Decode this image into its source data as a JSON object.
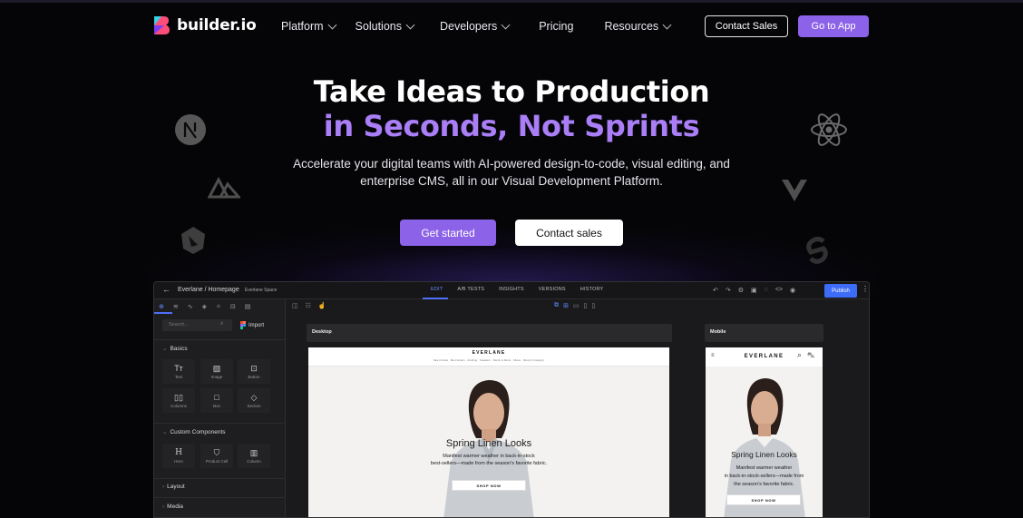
{
  "brand": {
    "name": "builder.io",
    "accent": "#8c63e8",
    "highlight": "#a97ef6"
  },
  "nav": {
    "links": [
      {
        "label": "Platform",
        "dropdown": true
      },
      {
        "label": "Solutions",
        "dropdown": true
      },
      {
        "label": "Developers",
        "dropdown": true
      },
      {
        "label": "Pricing",
        "dropdown": false
      },
      {
        "label": "Resources",
        "dropdown": true
      }
    ],
    "contact_sales": "Contact Sales",
    "go_to_app": "Go to App"
  },
  "hero": {
    "title_line1": "Take Ideas to Production",
    "title_line2": "in Seconds, Not Sprints",
    "subtitle": "Accelerate your digital teams with AI-powered design-to-code, visual editing, and enterprise CMS, all in our Visual Development Platform.",
    "get_started": "Get started",
    "contact_sales": "Contact sales"
  },
  "framework_icons": [
    "nextjs-icon",
    "astro-icon",
    "qwik-icon",
    "react-icon",
    "vue-icon",
    "svelte-icon"
  ],
  "editor": {
    "breadcrumb": "Everlane / Homepage",
    "space": "Everlane Space",
    "tabs": [
      "EDIT",
      "A/B TESTS",
      "INSIGHTS",
      "VERSIONS",
      "HISTORY"
    ],
    "active_tab": "EDIT",
    "publish": "Publish",
    "search_placeholder": "Search...",
    "import": "Import",
    "sections": {
      "basics": "Basics",
      "custom": "Custom Components",
      "layout": "Layout",
      "media": "Media"
    },
    "basics_blocks": [
      "Text",
      "Image",
      "Button",
      "Columns",
      "Box",
      "Section"
    ],
    "custom_blocks": [
      "Hero",
      "Product Cell",
      "Column"
    ],
    "frames": {
      "desktop": "Desktop",
      "mobile": "Mobile"
    },
    "site": {
      "logo": "EVERLANE",
      "nav": "New Arrivals · Best Sellers · Clothing · Sweaters · Denim & Pants · Shoes · Shop by Category",
      "hero_title": "Spring Linen Looks",
      "hero_sub_desktop_1": "Manifest warmer weather in back-in-stock",
      "hero_sub_desktop_2": "best-sellers—made from the season's favorite fabric.",
      "hero_sub_mobile_1": "Manifest warmer weather",
      "hero_sub_mobile_2": "in back-in-stock-sellers—made from",
      "hero_sub_mobile_3": "the season's favorite fabric.",
      "shop_now": "SHOP NOW"
    }
  }
}
